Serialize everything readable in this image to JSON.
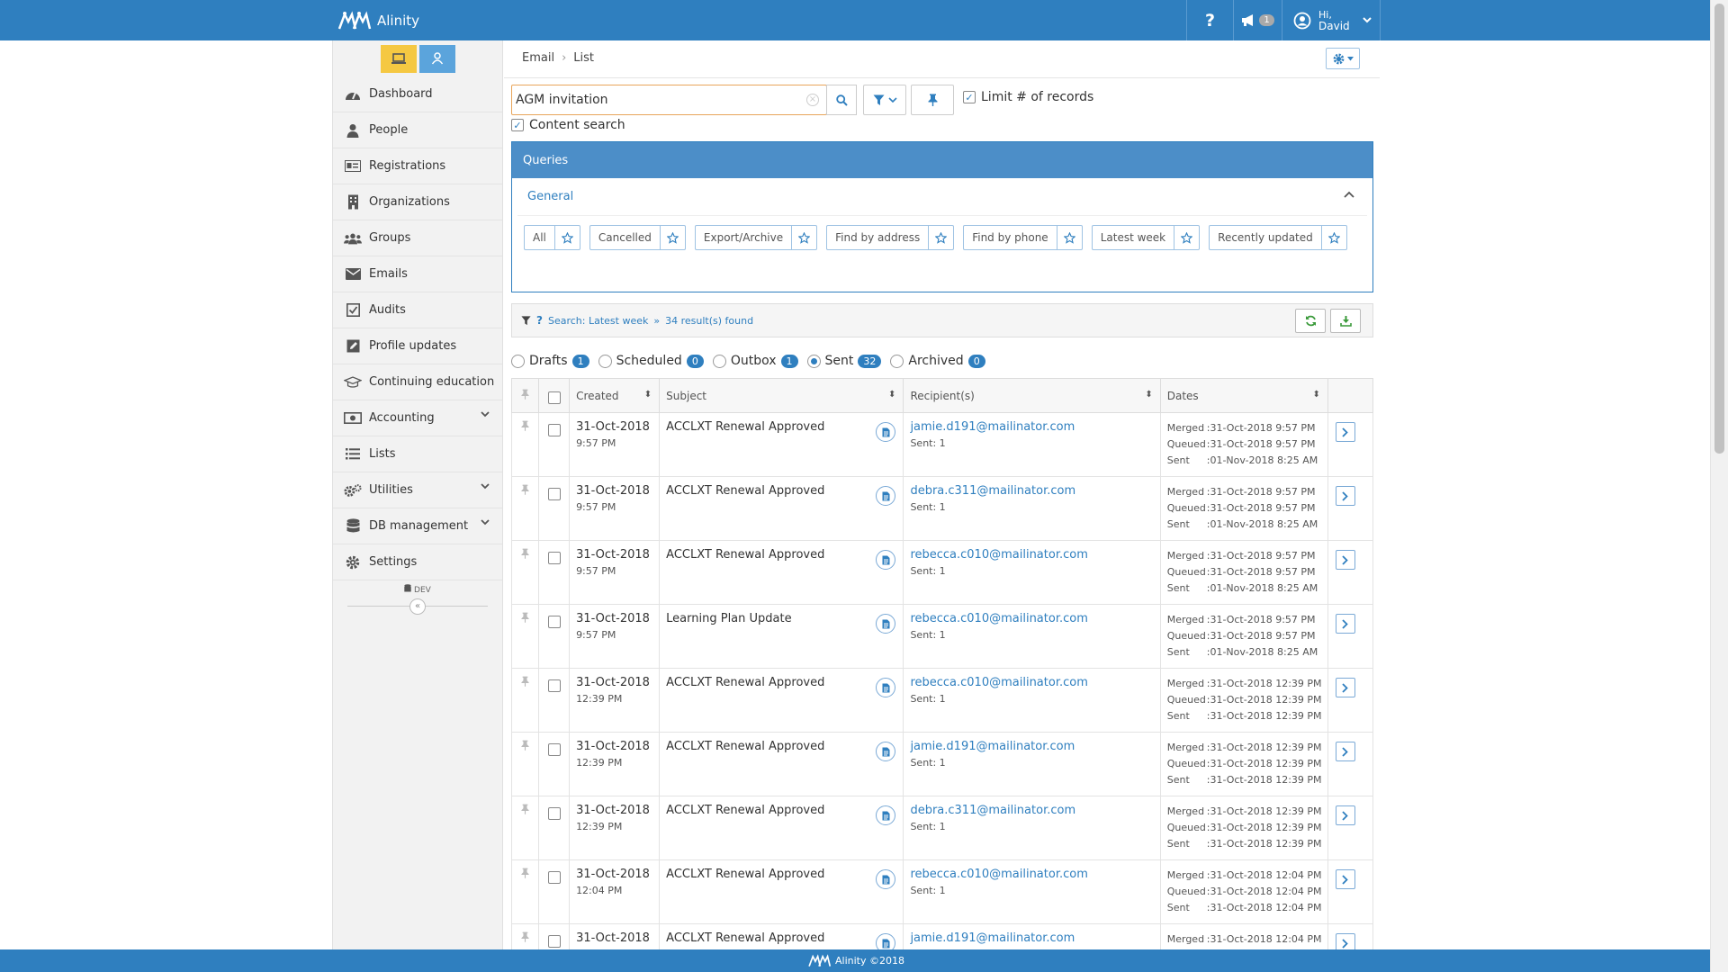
{
  "app": {
    "brand": "Alinity",
    "footer": "Alinity ©2018"
  },
  "header": {
    "help": "?",
    "announce_count": "1",
    "greeting": "Hi,",
    "user": "David"
  },
  "colors": {
    "primary": "#2f7fbf",
    "yellow": "#f5c842"
  },
  "sidebar": {
    "dev_label": "DEV",
    "items": [
      {
        "label": "Dashboard",
        "icon": "dashboard-icon"
      },
      {
        "label": "People",
        "icon": "person-icon"
      },
      {
        "label": "Registrations",
        "icon": "id-card-icon"
      },
      {
        "label": "Organizations",
        "icon": "building-icon"
      },
      {
        "label": "Groups",
        "icon": "users-icon"
      },
      {
        "label": "Emails",
        "icon": "envelope-icon"
      },
      {
        "label": "Audits",
        "icon": "check-square-icon"
      },
      {
        "label": "Profile updates",
        "icon": "edit-icon"
      },
      {
        "label": "Continuing education",
        "icon": "graduation-cap-icon"
      },
      {
        "label": "Accounting",
        "icon": "money-icon"
      },
      {
        "label": "Lists",
        "icon": "list-icon"
      },
      {
        "label": "Utilities",
        "icon": "cogs-icon"
      },
      {
        "label": "DB management",
        "icon": "database-icon"
      },
      {
        "label": "Settings",
        "icon": "gear-icon"
      }
    ]
  },
  "breadcrumb": {
    "root": "Email",
    "current": "List"
  },
  "search": {
    "value": "AGM invitation",
    "limit_label": "Limit # of records",
    "content_label": "Content search"
  },
  "queries": {
    "title": "Queries",
    "group": "General",
    "chips": [
      "All",
      "Cancelled",
      "Export/Archive",
      "Find by address",
      "Find by phone",
      "Latest week",
      "Recently updated"
    ]
  },
  "results": {
    "search_label": "Search: Latest week",
    "found": "34 result(s) found"
  },
  "statuses": [
    {
      "label": "Drafts",
      "count": "1"
    },
    {
      "label": "Scheduled",
      "count": "0"
    },
    {
      "label": "Outbox",
      "count": "1"
    },
    {
      "label": "Sent",
      "count": "32"
    },
    {
      "label": "Archived",
      "count": "0"
    }
  ],
  "table": {
    "headers": {
      "created": "Created",
      "subject": "Subject",
      "recipients": "Recipient(s)",
      "dates": "Dates"
    },
    "date_keys": {
      "merged": "Merged",
      "queued": "Queued",
      "sent": "Sent"
    },
    "rows": [
      {
        "date": "31-Oct-2018",
        "time": "9:57 PM",
        "subject": "ACCLXT Renewal Approved",
        "recipient": "jamie.d191@mailinator.com",
        "sent_count": "Sent: 1",
        "merged": ":31-Oct-2018 9:57 PM",
        "queued": ":31-Oct-2018 9:57 PM",
        "sent": ":01-Nov-2018 8:25 AM"
      },
      {
        "date": "31-Oct-2018",
        "time": "9:57 PM",
        "subject": "ACCLXT Renewal Approved",
        "recipient": "debra.c311@mailinator.com",
        "sent_count": "Sent: 1",
        "merged": ":31-Oct-2018 9:57 PM",
        "queued": ":31-Oct-2018 9:57 PM",
        "sent": ":01-Nov-2018 8:25 AM"
      },
      {
        "date": "31-Oct-2018",
        "time": "9:57 PM",
        "subject": "ACCLXT Renewal Approved",
        "recipient": "rebecca.c010@mailinator.com",
        "sent_count": "Sent: 1",
        "merged": ":31-Oct-2018 9:57 PM",
        "queued": ":31-Oct-2018 9:57 PM",
        "sent": ":01-Nov-2018 8:25 AM"
      },
      {
        "date": "31-Oct-2018",
        "time": "9:57 PM",
        "subject": "Learning Plan Update",
        "recipient": "rebecca.c010@mailinator.com",
        "sent_count": "Sent: 1",
        "merged": ":31-Oct-2018 9:57 PM",
        "queued": ":31-Oct-2018 9:57 PM",
        "sent": ":01-Nov-2018 8:25 AM"
      },
      {
        "date": "31-Oct-2018",
        "time": "12:39 PM",
        "subject": "ACCLXT Renewal Approved",
        "recipient": "rebecca.c010@mailinator.com",
        "sent_count": "Sent: 1",
        "merged": ":31-Oct-2018 12:39 PM",
        "queued": ":31-Oct-2018 12:39 PM",
        "sent": ":31-Oct-2018 12:39 PM"
      },
      {
        "date": "31-Oct-2018",
        "time": "12:39 PM",
        "subject": "ACCLXT Renewal Approved",
        "recipient": "jamie.d191@mailinator.com",
        "sent_count": "Sent: 1",
        "merged": ":31-Oct-2018 12:39 PM",
        "queued": ":31-Oct-2018 12:39 PM",
        "sent": ":31-Oct-2018 12:39 PM"
      },
      {
        "date": "31-Oct-2018",
        "time": "12:39 PM",
        "subject": "ACCLXT Renewal Approved",
        "recipient": "debra.c311@mailinator.com",
        "sent_count": "Sent: 1",
        "merged": ":31-Oct-2018 12:39 PM",
        "queued": ":31-Oct-2018 12:39 PM",
        "sent": ":31-Oct-2018 12:39 PM"
      },
      {
        "date": "31-Oct-2018",
        "time": "12:04 PM",
        "subject": "ACCLXT Renewal Approved",
        "recipient": "rebecca.c010@mailinator.com",
        "sent_count": "Sent: 1",
        "merged": ":31-Oct-2018 12:04 PM",
        "queued": ":31-Oct-2018 12:04 PM",
        "sent": ":31-Oct-2018 12:04 PM"
      },
      {
        "date": "31-Oct-2018",
        "time": "",
        "subject": "ACCLXT Renewal Approved",
        "recipient": "jamie.d191@mailinator.com",
        "sent_count": "",
        "merged": ":31-Oct-2018 12:04 PM",
        "queued": "",
        "sent": ""
      }
    ]
  }
}
